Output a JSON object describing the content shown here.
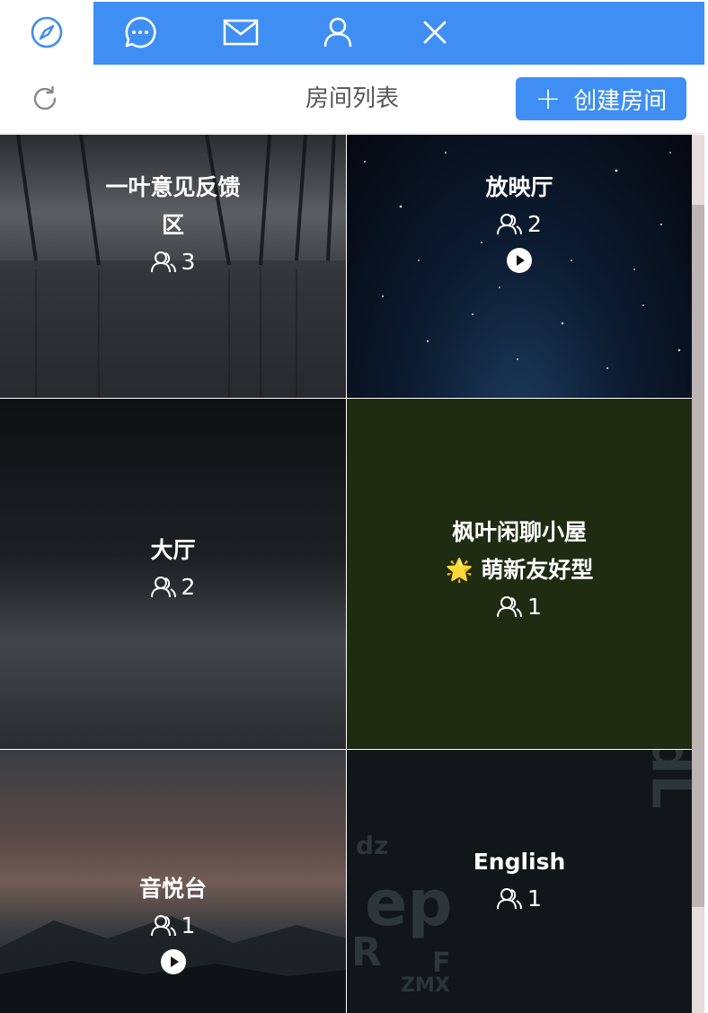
{
  "tabs": [
    {
      "icon": "compass-icon",
      "active": true
    },
    {
      "icon": "chat-bubble-icon",
      "active": false
    },
    {
      "icon": "mail-icon",
      "active": false
    },
    {
      "icon": "user-icon",
      "active": false
    },
    {
      "icon": "close-icon",
      "active": false
    }
  ],
  "header": {
    "title": "房间列表",
    "create_label": "创建房间",
    "refresh_icon": "refresh-icon"
  },
  "rooms": [
    {
      "name_line1": "一叶意见反馈",
      "name_line2": "区",
      "count": "3",
      "playing": false
    },
    {
      "name_line1": "放映厅",
      "count": "2",
      "playing": true
    },
    {
      "name_line1": "大厅",
      "count": "2",
      "playing": false
    },
    {
      "name_line1": "枫叶闲聊小屋",
      "name_line2": "🌟 萌新友好型",
      "count": "1",
      "playing": false
    },
    {
      "name_line1": "音悦台",
      "count": "1",
      "playing": true
    },
    {
      "name_line1": "English",
      "count": "1",
      "playing": false
    }
  ],
  "colors": {
    "accent": "#3f8ef3",
    "scroll_thumb": "#beb4b4"
  }
}
